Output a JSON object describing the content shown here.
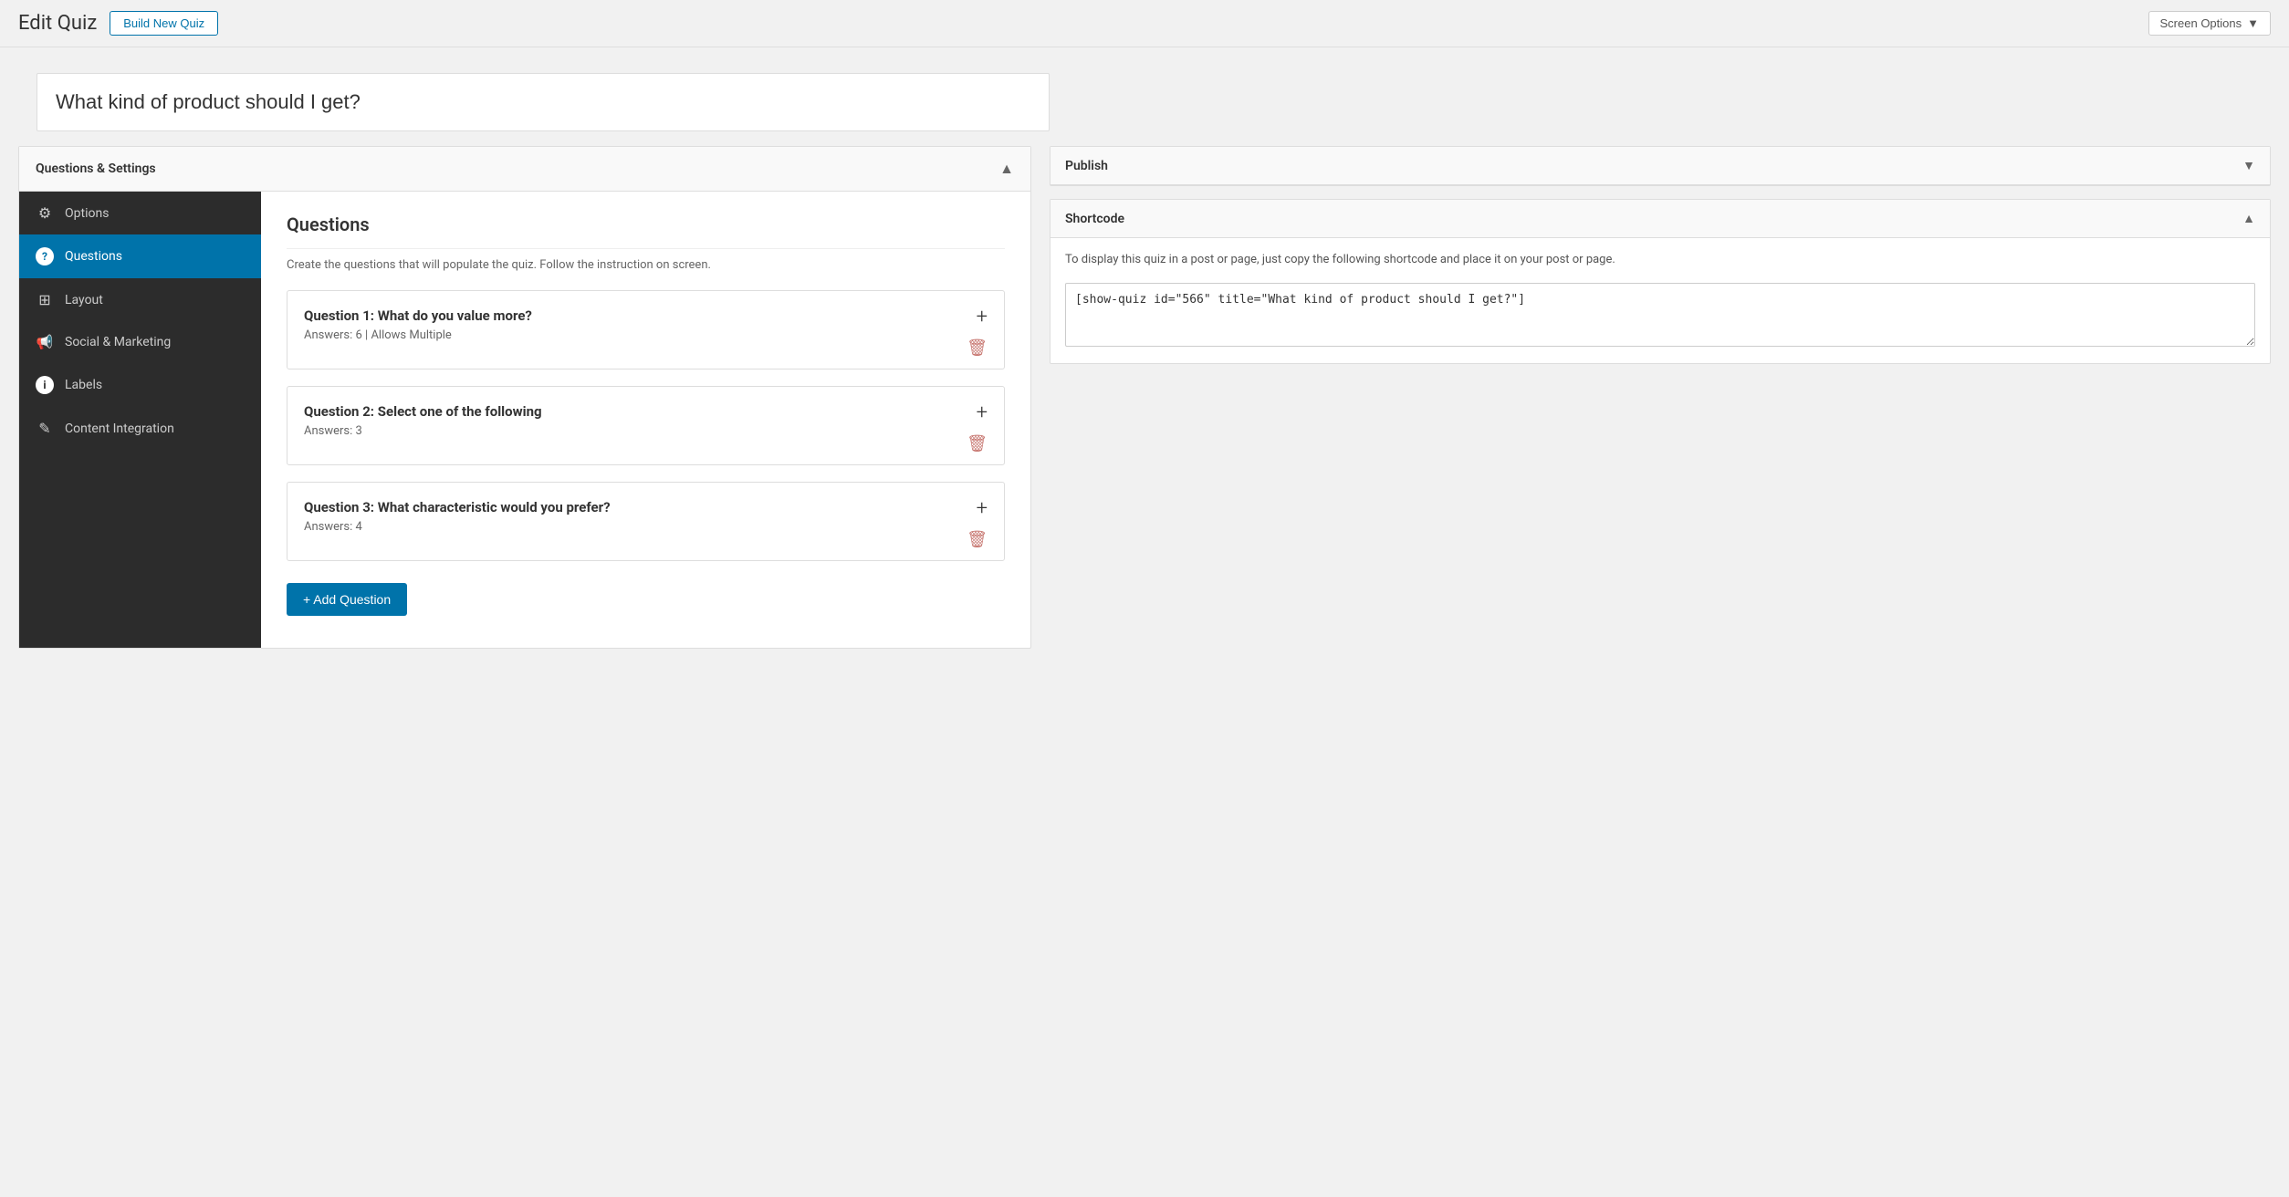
{
  "header": {
    "title": "Edit Quiz",
    "build_new_quiz_label": "Build New Quiz",
    "screen_options_label": "Screen Options"
  },
  "quiz_title_input": {
    "value": "What kind of product should I get?",
    "placeholder": "What kind of product should I get?"
  },
  "left_panel": {
    "title": "Questions & Settings",
    "collapse_icon": "▲",
    "sidebar": {
      "items": [
        {
          "id": "options",
          "label": "Options",
          "icon": "gear"
        },
        {
          "id": "questions",
          "label": "Questions",
          "icon": "question",
          "active": true
        },
        {
          "id": "layout",
          "label": "Layout",
          "icon": "layout"
        },
        {
          "id": "social-marketing",
          "label": "Social & Marketing",
          "icon": "marketing"
        },
        {
          "id": "labels",
          "label": "Labels",
          "icon": "labels"
        },
        {
          "id": "content-integration",
          "label": "Content Integration",
          "icon": "integration"
        }
      ]
    },
    "content": {
      "section_title": "Questions",
      "section_desc": "Create the questions that will populate the quiz. Follow the instruction on screen.",
      "questions": [
        {
          "id": 1,
          "title": "Question 1: What do you value more?",
          "meta": "Answers: 6 | Allows Multiple"
        },
        {
          "id": 2,
          "title": "Question 2: Select one of the following",
          "meta": "Answers: 3"
        },
        {
          "id": 3,
          "title": "Question 3: What characteristic would you prefer?",
          "meta": "Answers: 4"
        }
      ],
      "add_question_label": "+ Add Question"
    }
  },
  "right_panel": {
    "publish": {
      "title": "Publish",
      "chevron": "▼"
    },
    "shortcode": {
      "title": "Shortcode",
      "chevron": "▲",
      "desc": "To display this quiz in a post or page, just copy the following shortcode and place it on your post or page.",
      "code": "[show-quiz id=\"566\" title=\"What kind of product should I get?\"]"
    }
  }
}
